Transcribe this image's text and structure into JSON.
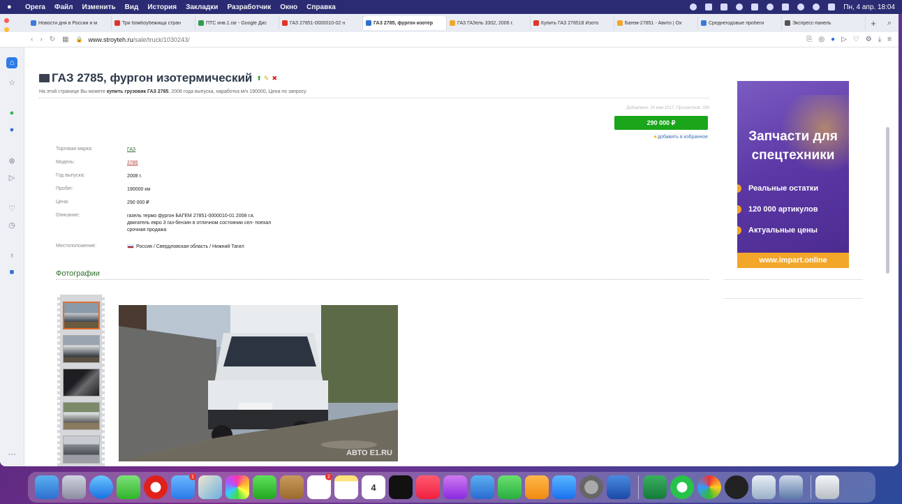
{
  "menubar": {
    "items": [
      "Opera",
      "Файл",
      "Изменить",
      "Вид",
      "История",
      "Закладки",
      "Разработчик",
      "Окно",
      "Справка"
    ],
    "clock": "Пн, 4 апр. 18:04"
  },
  "tabs": [
    {
      "title": "Новости дня в России и м",
      "color": "#3b7bd8"
    },
    {
      "title": "Три бомбоубежища стран",
      "color": "#e0342c"
    },
    {
      "title": "ПТС инв.1.rar - Google Дис",
      "color": "#2f9e4a"
    },
    {
      "title": "ГАЗ 27851-0000010-02 н",
      "color": "#e0342c"
    },
    {
      "title": "ГАЗ 2785, фургон изотер",
      "color": "#2e6fd0",
      "active": true
    },
    {
      "title": "ГАЗ ГАЗель 3302, 2006 г.",
      "color": "#f2a62a"
    },
    {
      "title": "Купить ГАЗ 278518 Изото",
      "color": "#e0342c"
    },
    {
      "title": "Багем-27851 - Авито | Ох",
      "color": "#f2a62a"
    },
    {
      "title": "Среднегодовые пробеги",
      "color": "#3b7bd8"
    },
    {
      "title": "Экспресс-панель",
      "color": "#555"
    }
  ],
  "address": {
    "domain": "www.stroyteh.ru",
    "path": "/sale/truck/1030243/"
  },
  "listing": {
    "title": "ГАЗ 2785, фургон изотермический",
    "subtitle_prefix": "На этой странице Вы можете ",
    "subtitle_bold": "купить грузовик ГАЗ 2785",
    "subtitle_suffix": ", 2008 года выпуска, наработка м/ч 190000, Цена по запросу",
    "meta": "Добавлено: 24 мая 2017, Просмотров: 289",
    "price_button": "290 000 ₽",
    "favorite_link": "добавить в избранное",
    "specs": [
      {
        "label": "Торговая марка:",
        "value": "ГАЗ"
      },
      {
        "label": "Модель:",
        "value": "2785"
      },
      {
        "label": "Год выпуска:",
        "value": "2008 г."
      },
      {
        "label": "Пробег:",
        "value": "190000 км"
      },
      {
        "label": "Цена:",
        "value": "290 000 ₽"
      },
      {
        "label": "Описание:",
        "value_lines": [
          "газель термо фургон БАГЕМ 27851-0000010-01 2008 г.в.",
          "двигатель евро 3 газ-бензин в отличном состоянии сел- поехал",
          "срочная продажа"
        ]
      },
      {
        "label": "Местоположение:",
        "value": "Россия / Свердловская область / Нижний Тагил"
      }
    ],
    "photos_heading": "Фотографии",
    "watermark": "АВТО Е1.RU"
  },
  "ad": {
    "title_line1": "Запчасти для",
    "title_line2": "спецтехники",
    "bullets": [
      "Реальные остатки",
      "120 000 артикулов",
      "Актуальные цены"
    ],
    "url": "www.impart.online"
  },
  "dock": {
    "calendar_day": "4",
    "mail_badge": "1",
    "reminders_badge": "2"
  }
}
